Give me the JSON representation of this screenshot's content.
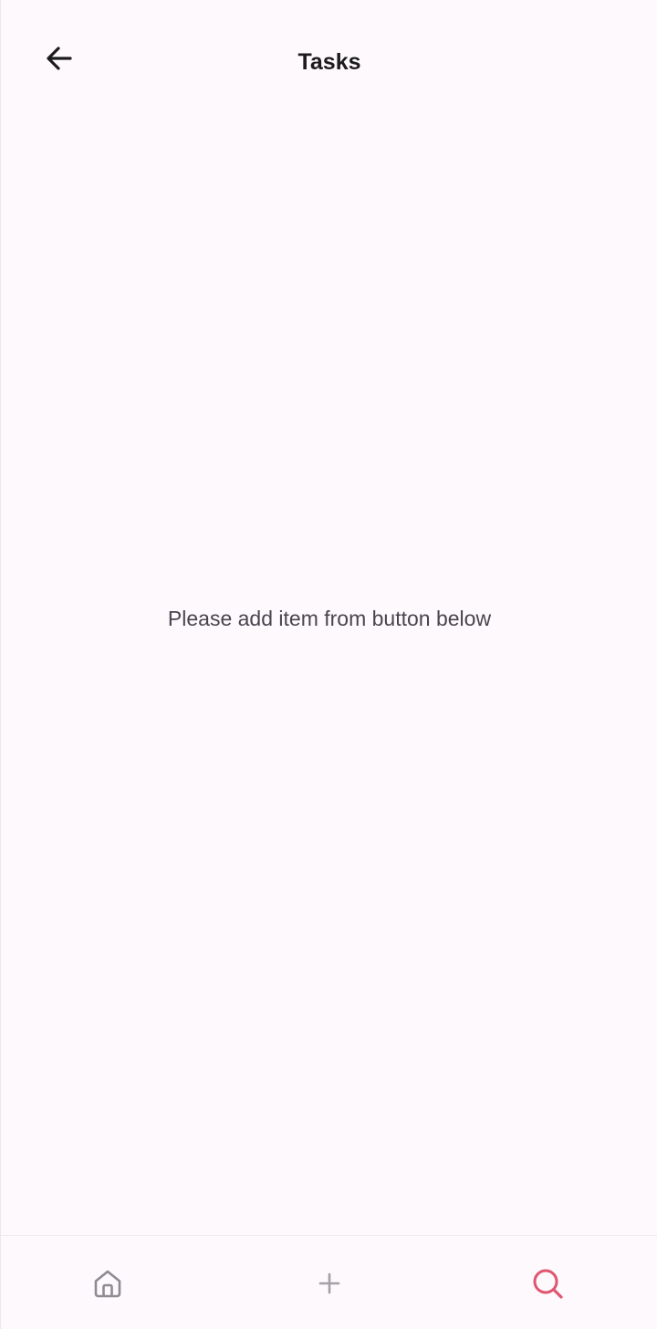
{
  "header": {
    "title": "Tasks",
    "back_icon": "arrow-left-icon"
  },
  "main": {
    "empty_message": "Please add item from button below"
  },
  "bottom_nav": {
    "items": [
      {
        "icon": "home-icon",
        "active": false
      },
      {
        "icon": "plus-icon",
        "active": false
      },
      {
        "icon": "search-icon",
        "active": true
      }
    ],
    "colors": {
      "inactive": "#8e8c91",
      "active": "#e0566f"
    }
  }
}
